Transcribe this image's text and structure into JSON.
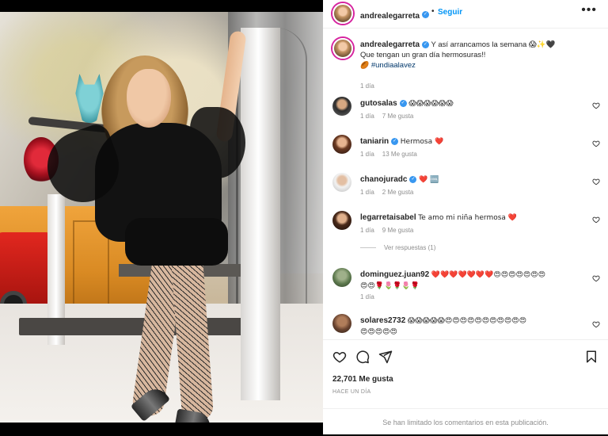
{
  "post": {
    "author": "andrealegarreta",
    "follow_label": "Seguir",
    "separator": "•",
    "more_label": "•••",
    "caption_text": "Y así arrancamos la semana 😱✨🖤",
    "caption_line2": "Que tengan un gran día hermosuras!!",
    "caption_emoji": "🏉",
    "hashtag": "#undiaalavez",
    "caption_time": "1 día",
    "likes": "22,701 Me gusta",
    "ago": "Hace un día",
    "comments_limited": "Se han limitado los comentarios en esta publicación."
  },
  "comments": [
    {
      "user": "gutosalas",
      "verified": true,
      "text": "😱😱😱😱😱😱",
      "time": "1 día",
      "likes": "7 Me gusta"
    },
    {
      "user": "taniarin",
      "verified": true,
      "text": "Hermosa ❤️",
      "time": "1 día",
      "likes": "13 Me gusta"
    },
    {
      "user": "chanojuradc",
      "verified": true,
      "text": "❤️ 🆒",
      "time": "1 día",
      "likes": "2 Me gusta"
    },
    {
      "user": "legarretaisabel",
      "verified": false,
      "text": "Te amo mi niña hermosa ❤️",
      "time": "1 día",
      "likes": "9 Me gusta",
      "replies": "Ver respuestas (1)"
    },
    {
      "user": "dominguez.juan92",
      "verified": false,
      "text": "❤️❤️❤️❤️❤️❤️❤️😍😍😍😍😍😍😍",
      "text2": "😍😍🌹🌷🌹🌷🌹",
      "time": "1 día"
    },
    {
      "user": "solares2732",
      "verified": false,
      "text": "😱😱😱😱😱😍😍😍😍😍😍😍😍😍😍😍",
      "text2": "😍😍😍😍😍"
    }
  ],
  "icons": {
    "like": "heart-icon",
    "comment": "comment-icon",
    "share": "share-icon",
    "save": "bookmark-icon"
  },
  "colors": {
    "accent": "#0095f6",
    "verified": "#3897f0",
    "heart_red": "#ed4956"
  }
}
